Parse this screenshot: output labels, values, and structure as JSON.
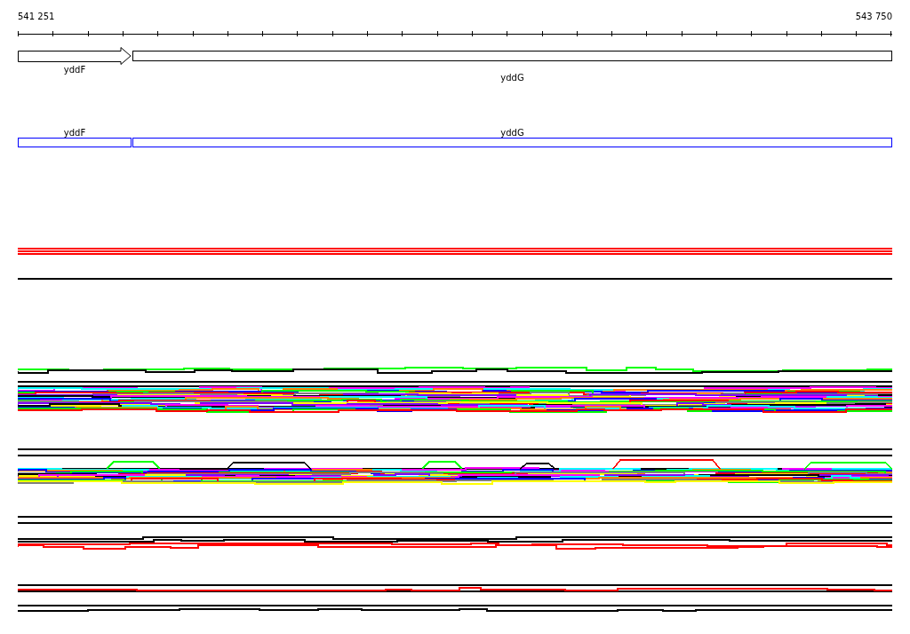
{
  "ruler": {
    "start": "541 251",
    "end": "543 750"
  },
  "genes": [
    {
      "name": "yddF",
      "kind": "arrow"
    },
    {
      "name": "yddG",
      "kind": "box"
    }
  ],
  "transcripts": [
    {
      "name": "yddF"
    },
    {
      "name": "yddG"
    }
  ]
}
